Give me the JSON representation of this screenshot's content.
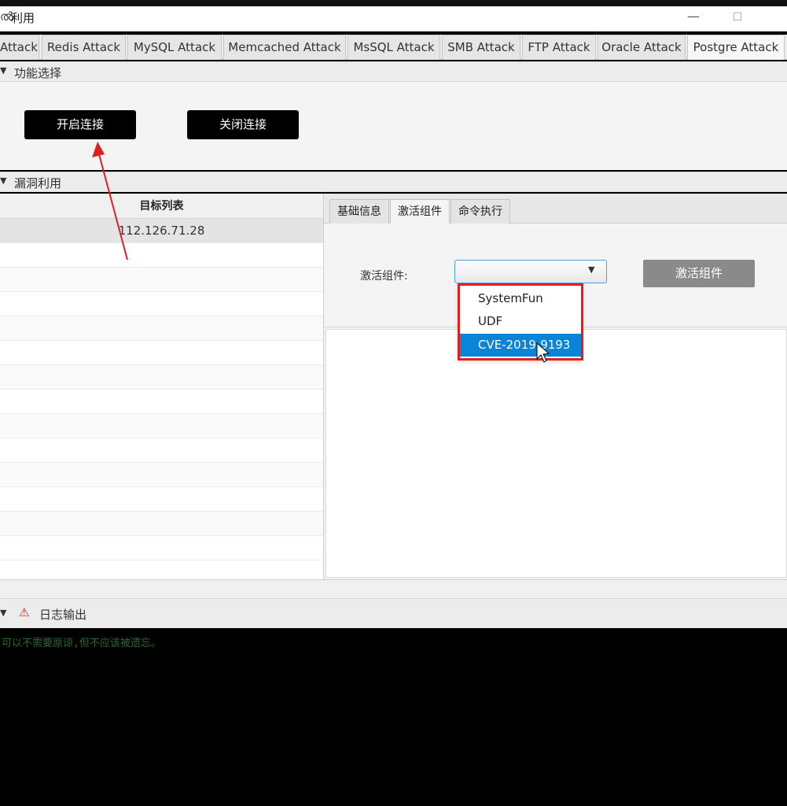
{
  "window": {
    "title": "利用",
    "icon_glyph": "ൽ",
    "minimize_glyph": "—",
    "maximize_glyph": "☐"
  },
  "tabs": [
    {
      "label": "Attack",
      "active": false
    },
    {
      "label": "Redis Attack",
      "active": false
    },
    {
      "label": "MySQL Attack",
      "active": false
    },
    {
      "label": "Memcached Attack",
      "active": false
    },
    {
      "label": "MsSQL Attack",
      "active": false
    },
    {
      "label": "SMB Attack",
      "active": false
    },
    {
      "label": "FTP Attack",
      "active": false
    },
    {
      "label": "Oracle Attack",
      "active": false
    },
    {
      "label": "Postgre Attack",
      "active": true
    }
  ],
  "section_function": {
    "title": "功能选择",
    "open_button": "开启连接",
    "close_button": "关闭连接"
  },
  "section_exploit": {
    "title": "漏洞利用",
    "target_list_header": "目标列表",
    "targets": [
      "112.126.71.28"
    ],
    "sub_tabs": [
      {
        "label": "基础信息",
        "active": false
      },
      {
        "label": "激活组件",
        "active": true
      },
      {
        "label": "命令执行",
        "active": false
      }
    ],
    "field_label": "激活组件:",
    "combo_value": "",
    "activate_button": "激活组件",
    "dropdown_options": [
      {
        "label": "SystemFun",
        "selected": false
      },
      {
        "label": "UDF",
        "selected": false
      },
      {
        "label": "CVE-2019-9193",
        "selected": true
      }
    ]
  },
  "section_log": {
    "title": "日志输出",
    "warning_glyph": "⚠",
    "console_text": "可以不需要原谅,但不应该被遗忘。"
  },
  "colors": {
    "accent_blue": "#0a84d6",
    "annotation_red": "#e02020",
    "console_green": "#2a6a2a"
  }
}
